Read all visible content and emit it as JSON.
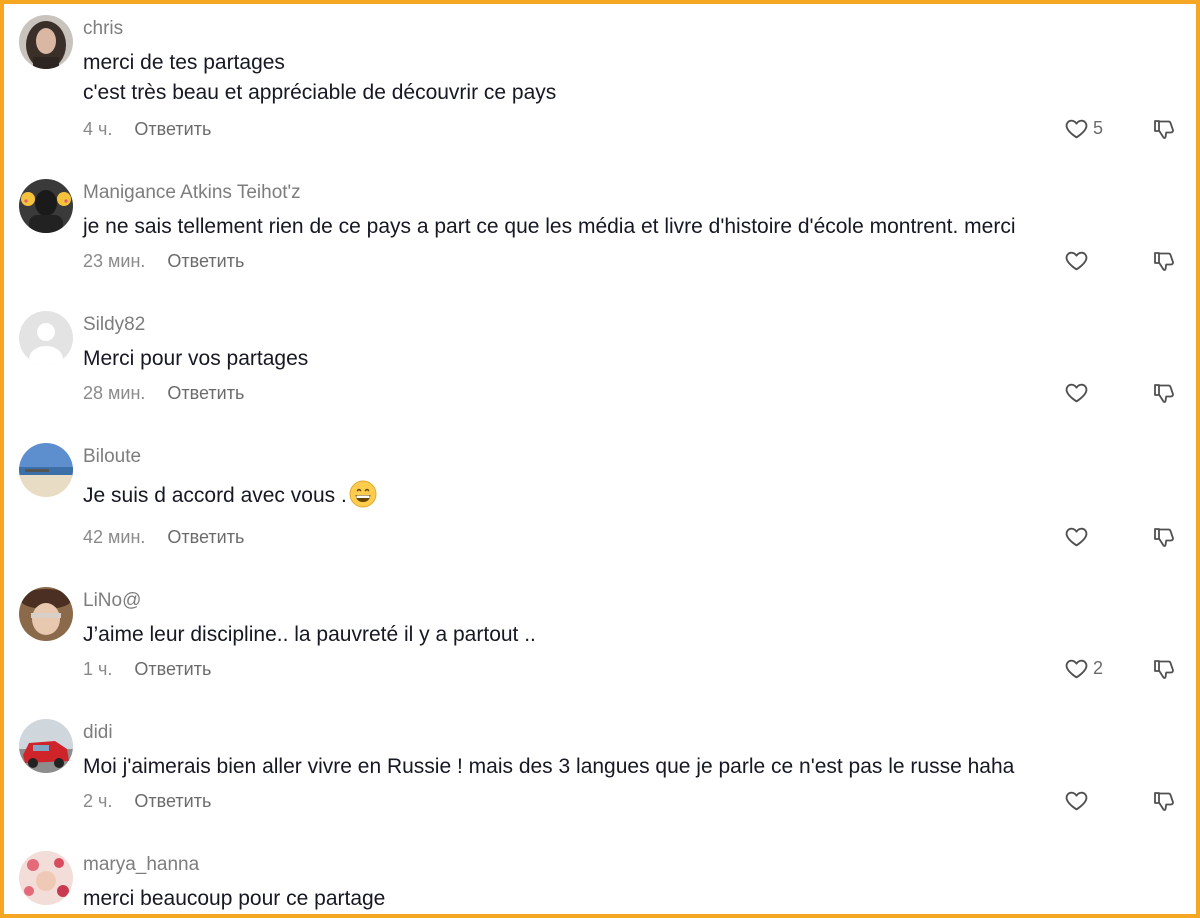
{
  "reply_label": "Ответить",
  "comments": [
    {
      "username": "chris",
      "lines": [
        "merci de tes partages",
        "c'est très beau et appréciable de découvrir ce pays"
      ],
      "time": "4 ч.",
      "likes": "5",
      "avatar": "woman-dark-hair-avatar"
    },
    {
      "username": "Manigance Atkins Teihot'z",
      "lines": [
        "je ne sais tellement rien de ce pays a part ce que les média et livre d'histoire d'école montrent. merci"
      ],
      "time": "23 мин.",
      "likes": "",
      "avatar": "dark-silhouette-avatar"
    },
    {
      "username": "Sildy82",
      "lines": [
        "Merci pour vos partages"
      ],
      "time": "28 мин.",
      "likes": "",
      "avatar": "default-avatar"
    },
    {
      "username": "Biloute",
      "lines": [
        "Je suis d accord avec vous ."
      ],
      "emoji": "grinning-face-emoji",
      "time": "42 мин.",
      "likes": "",
      "avatar": "beach-avatar"
    },
    {
      "username": "LiNo@",
      "lines": [
        "J’aime leur discipline.. la pauvreté il y a partout .."
      ],
      "time": "1 ч.",
      "likes": "2",
      "avatar": "woman-hat-avatar"
    },
    {
      "username": "didi",
      "lines": [
        "Moi j'aimerais bien aller vivre en Russie ! mais des 3 langues que je parle ce n'est pas le russe haha"
      ],
      "time": "2 ч.",
      "likes": "",
      "avatar": "red-car-avatar"
    },
    {
      "username": "marya_hanna",
      "lines": [
        "merci beaucoup pour ce partage"
      ],
      "time": "",
      "likes": "",
      "avatar": "flowers-avatar"
    }
  ],
  "colors": {
    "frame": "#f5a623",
    "username": "#7d7d7d",
    "text": "#161823",
    "meta": "#8a8a8a"
  }
}
